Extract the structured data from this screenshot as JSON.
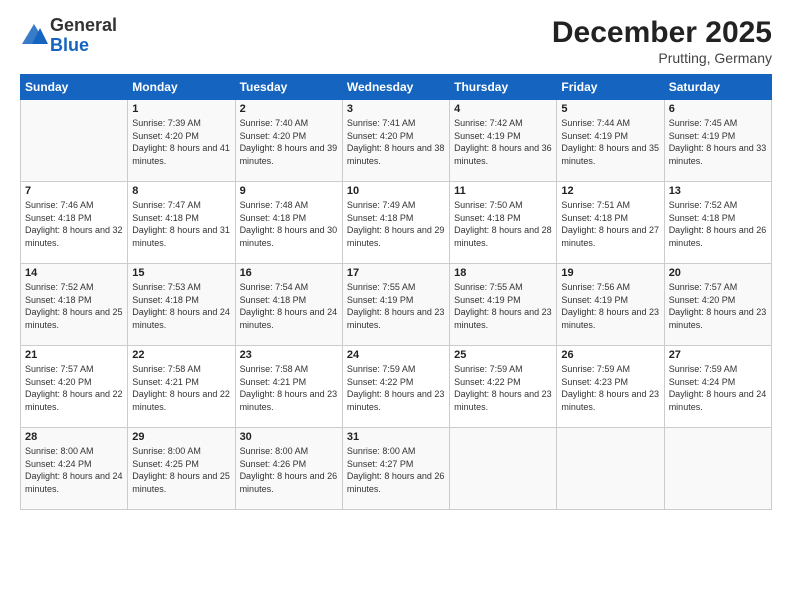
{
  "header": {
    "logo_general": "General",
    "logo_blue": "Blue",
    "month_title": "December 2025",
    "location": "Prutting, Germany"
  },
  "days_of_week": [
    "Sunday",
    "Monday",
    "Tuesday",
    "Wednesday",
    "Thursday",
    "Friday",
    "Saturday"
  ],
  "weeks": [
    [
      {
        "day": "",
        "sunrise": "",
        "sunset": "",
        "daylight": ""
      },
      {
        "day": "1",
        "sunrise": "Sunrise: 7:39 AM",
        "sunset": "Sunset: 4:20 PM",
        "daylight": "Daylight: 8 hours and 41 minutes."
      },
      {
        "day": "2",
        "sunrise": "Sunrise: 7:40 AM",
        "sunset": "Sunset: 4:20 PM",
        "daylight": "Daylight: 8 hours and 39 minutes."
      },
      {
        "day": "3",
        "sunrise": "Sunrise: 7:41 AM",
        "sunset": "Sunset: 4:20 PM",
        "daylight": "Daylight: 8 hours and 38 minutes."
      },
      {
        "day": "4",
        "sunrise": "Sunrise: 7:42 AM",
        "sunset": "Sunset: 4:19 PM",
        "daylight": "Daylight: 8 hours and 36 minutes."
      },
      {
        "day": "5",
        "sunrise": "Sunrise: 7:44 AM",
        "sunset": "Sunset: 4:19 PM",
        "daylight": "Daylight: 8 hours and 35 minutes."
      },
      {
        "day": "6",
        "sunrise": "Sunrise: 7:45 AM",
        "sunset": "Sunset: 4:19 PM",
        "daylight": "Daylight: 8 hours and 33 minutes."
      }
    ],
    [
      {
        "day": "7",
        "sunrise": "Sunrise: 7:46 AM",
        "sunset": "Sunset: 4:18 PM",
        "daylight": "Daylight: 8 hours and 32 minutes."
      },
      {
        "day": "8",
        "sunrise": "Sunrise: 7:47 AM",
        "sunset": "Sunset: 4:18 PM",
        "daylight": "Daylight: 8 hours and 31 minutes."
      },
      {
        "day": "9",
        "sunrise": "Sunrise: 7:48 AM",
        "sunset": "Sunset: 4:18 PM",
        "daylight": "Daylight: 8 hours and 30 minutes."
      },
      {
        "day": "10",
        "sunrise": "Sunrise: 7:49 AM",
        "sunset": "Sunset: 4:18 PM",
        "daylight": "Daylight: 8 hours and 29 minutes."
      },
      {
        "day": "11",
        "sunrise": "Sunrise: 7:50 AM",
        "sunset": "Sunset: 4:18 PM",
        "daylight": "Daylight: 8 hours and 28 minutes."
      },
      {
        "day": "12",
        "sunrise": "Sunrise: 7:51 AM",
        "sunset": "Sunset: 4:18 PM",
        "daylight": "Daylight: 8 hours and 27 minutes."
      },
      {
        "day": "13",
        "sunrise": "Sunrise: 7:52 AM",
        "sunset": "Sunset: 4:18 PM",
        "daylight": "Daylight: 8 hours and 26 minutes."
      }
    ],
    [
      {
        "day": "14",
        "sunrise": "Sunrise: 7:52 AM",
        "sunset": "Sunset: 4:18 PM",
        "daylight": "Daylight: 8 hours and 25 minutes."
      },
      {
        "day": "15",
        "sunrise": "Sunrise: 7:53 AM",
        "sunset": "Sunset: 4:18 PM",
        "daylight": "Daylight: 8 hours and 24 minutes."
      },
      {
        "day": "16",
        "sunrise": "Sunrise: 7:54 AM",
        "sunset": "Sunset: 4:18 PM",
        "daylight": "Daylight: 8 hours and 24 minutes."
      },
      {
        "day": "17",
        "sunrise": "Sunrise: 7:55 AM",
        "sunset": "Sunset: 4:19 PM",
        "daylight": "Daylight: 8 hours and 23 minutes."
      },
      {
        "day": "18",
        "sunrise": "Sunrise: 7:55 AM",
        "sunset": "Sunset: 4:19 PM",
        "daylight": "Daylight: 8 hours and 23 minutes."
      },
      {
        "day": "19",
        "sunrise": "Sunrise: 7:56 AM",
        "sunset": "Sunset: 4:19 PM",
        "daylight": "Daylight: 8 hours and 23 minutes."
      },
      {
        "day": "20",
        "sunrise": "Sunrise: 7:57 AM",
        "sunset": "Sunset: 4:20 PM",
        "daylight": "Daylight: 8 hours and 23 minutes."
      }
    ],
    [
      {
        "day": "21",
        "sunrise": "Sunrise: 7:57 AM",
        "sunset": "Sunset: 4:20 PM",
        "daylight": "Daylight: 8 hours and 22 minutes."
      },
      {
        "day": "22",
        "sunrise": "Sunrise: 7:58 AM",
        "sunset": "Sunset: 4:21 PM",
        "daylight": "Daylight: 8 hours and 22 minutes."
      },
      {
        "day": "23",
        "sunrise": "Sunrise: 7:58 AM",
        "sunset": "Sunset: 4:21 PM",
        "daylight": "Daylight: 8 hours and 23 minutes."
      },
      {
        "day": "24",
        "sunrise": "Sunrise: 7:59 AM",
        "sunset": "Sunset: 4:22 PM",
        "daylight": "Daylight: 8 hours and 23 minutes."
      },
      {
        "day": "25",
        "sunrise": "Sunrise: 7:59 AM",
        "sunset": "Sunset: 4:22 PM",
        "daylight": "Daylight: 8 hours and 23 minutes."
      },
      {
        "day": "26",
        "sunrise": "Sunrise: 7:59 AM",
        "sunset": "Sunset: 4:23 PM",
        "daylight": "Daylight: 8 hours and 23 minutes."
      },
      {
        "day": "27",
        "sunrise": "Sunrise: 7:59 AM",
        "sunset": "Sunset: 4:24 PM",
        "daylight": "Daylight: 8 hours and 24 minutes."
      }
    ],
    [
      {
        "day": "28",
        "sunrise": "Sunrise: 8:00 AM",
        "sunset": "Sunset: 4:24 PM",
        "daylight": "Daylight: 8 hours and 24 minutes."
      },
      {
        "day": "29",
        "sunrise": "Sunrise: 8:00 AM",
        "sunset": "Sunset: 4:25 PM",
        "daylight": "Daylight: 8 hours and 25 minutes."
      },
      {
        "day": "30",
        "sunrise": "Sunrise: 8:00 AM",
        "sunset": "Sunset: 4:26 PM",
        "daylight": "Daylight: 8 hours and 26 minutes."
      },
      {
        "day": "31",
        "sunrise": "Sunrise: 8:00 AM",
        "sunset": "Sunset: 4:27 PM",
        "daylight": "Daylight: 8 hours and 26 minutes."
      },
      {
        "day": "",
        "sunrise": "",
        "sunset": "",
        "daylight": ""
      },
      {
        "day": "",
        "sunrise": "",
        "sunset": "",
        "daylight": ""
      },
      {
        "day": "",
        "sunrise": "",
        "sunset": "",
        "daylight": ""
      }
    ]
  ]
}
